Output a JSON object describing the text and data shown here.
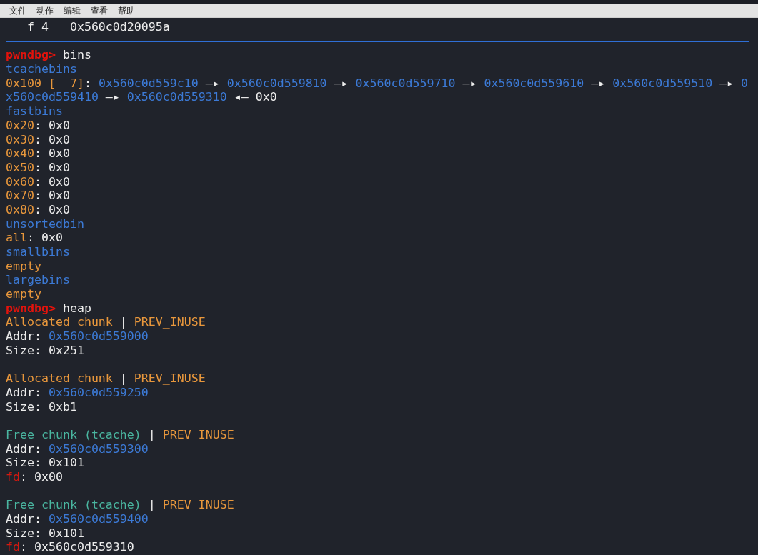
{
  "menu_bar": {
    "items": [
      "文件",
      "动作",
      "编辑",
      "查看",
      "帮助"
    ]
  },
  "terminal": {
    "lines": [
      {
        "kind": "frame",
        "text": "f 4   0x560c0d20095a"
      },
      {
        "kind": "separator"
      },
      {
        "kind": "output",
        "segments": [
          {
            "kind": "prompt",
            "text": "pwndbg>"
          },
          {
            "kind": "text",
            "text": " bins"
          }
        ]
      },
      {
        "kind": "output",
        "segments": [
          {
            "kind": "heading",
            "text": "tcachebins"
          }
        ]
      },
      {
        "kind": "output",
        "segments": [
          {
            "kind": "bin",
            "text": "0x100 [  7]"
          },
          {
            "kind": "text",
            "text": ": "
          },
          {
            "kind": "address",
            "text": "0x560c0d559c10"
          },
          {
            "kind": "text",
            "text": " —▸ "
          },
          {
            "kind": "address",
            "text": "0x560c0d559810"
          },
          {
            "kind": "text",
            "text": " —▸ "
          },
          {
            "kind": "address",
            "text": "0x560c0d559710"
          },
          {
            "kind": "text",
            "text": " —▸ "
          },
          {
            "kind": "address",
            "text": "0x560c0d559610"
          },
          {
            "kind": "text",
            "text": " —▸ "
          },
          {
            "kind": "address",
            "text": "0x560c0d559510"
          },
          {
            "kind": "text",
            "text": " —▸ "
          },
          {
            "kind": "address",
            "text": "0"
          }
        ]
      },
      {
        "kind": "output",
        "segments": [
          {
            "kind": "address",
            "text": "x560c0d559410"
          },
          {
            "kind": "text",
            "text": " —▸ "
          },
          {
            "kind": "address",
            "text": "0x560c0d559310"
          },
          {
            "kind": "text",
            "text": " ◂— 0x0"
          }
        ]
      },
      {
        "kind": "output",
        "segments": [
          {
            "kind": "heading",
            "text": "fastbins"
          }
        ]
      },
      {
        "kind": "output",
        "segments": [
          {
            "kind": "bin",
            "text": "0x20"
          },
          {
            "kind": "text",
            "text": ": 0x0"
          }
        ]
      },
      {
        "kind": "output",
        "segments": [
          {
            "kind": "bin",
            "text": "0x30"
          },
          {
            "kind": "text",
            "text": ": 0x0"
          }
        ]
      },
      {
        "kind": "output",
        "segments": [
          {
            "kind": "bin",
            "text": "0x40"
          },
          {
            "kind": "text",
            "text": ": 0x0"
          }
        ]
      },
      {
        "kind": "output",
        "segments": [
          {
            "kind": "bin",
            "text": "0x50"
          },
          {
            "kind": "text",
            "text": ": 0x0"
          }
        ]
      },
      {
        "kind": "output",
        "segments": [
          {
            "kind": "bin",
            "text": "0x60"
          },
          {
            "kind": "text",
            "text": ": 0x0"
          }
        ]
      },
      {
        "kind": "output",
        "segments": [
          {
            "kind": "bin",
            "text": "0x70"
          },
          {
            "kind": "text",
            "text": ": 0x0"
          }
        ]
      },
      {
        "kind": "output",
        "segments": [
          {
            "kind": "bin",
            "text": "0x80"
          },
          {
            "kind": "text",
            "text": ": 0x0"
          }
        ]
      },
      {
        "kind": "output",
        "segments": [
          {
            "kind": "heading",
            "text": "unsortedbin"
          }
        ]
      },
      {
        "kind": "output",
        "segments": [
          {
            "kind": "bin",
            "text": "all"
          },
          {
            "kind": "text",
            "text": ": 0x0"
          }
        ]
      },
      {
        "kind": "output",
        "segments": [
          {
            "kind": "heading",
            "text": "smallbins"
          }
        ]
      },
      {
        "kind": "output",
        "segments": [
          {
            "kind": "bin",
            "text": "empty"
          }
        ]
      },
      {
        "kind": "output",
        "segments": [
          {
            "kind": "heading",
            "text": "largebins"
          }
        ]
      },
      {
        "kind": "output",
        "segments": [
          {
            "kind": "bin",
            "text": "empty"
          }
        ]
      },
      {
        "kind": "output",
        "segments": [
          {
            "kind": "prompt",
            "text": "pwndbg>"
          },
          {
            "kind": "text",
            "text": " heap"
          }
        ]
      },
      {
        "kind": "output",
        "segments": [
          {
            "kind": "bin",
            "text": "Allocated chunk"
          },
          {
            "kind": "text",
            "text": " | "
          },
          {
            "kind": "bin",
            "text": "PREV_INUSE"
          }
        ]
      },
      {
        "kind": "output",
        "segments": [
          {
            "kind": "text",
            "text": "Addr: "
          },
          {
            "kind": "address",
            "text": "0x560c0d559000"
          }
        ]
      },
      {
        "kind": "output",
        "segments": [
          {
            "kind": "text",
            "text": "Size: 0x251"
          }
        ]
      },
      {
        "kind": "blank"
      },
      {
        "kind": "output",
        "segments": [
          {
            "kind": "bin",
            "text": "Allocated chunk"
          },
          {
            "kind": "text",
            "text": " | "
          },
          {
            "kind": "bin",
            "text": "PREV_INUSE"
          }
        ]
      },
      {
        "kind": "output",
        "segments": [
          {
            "kind": "text",
            "text": "Addr: "
          },
          {
            "kind": "address",
            "text": "0x560c0d559250"
          }
        ]
      },
      {
        "kind": "output",
        "segments": [
          {
            "kind": "text",
            "text": "Size: 0xb1"
          }
        ]
      },
      {
        "kind": "blank"
      },
      {
        "kind": "output",
        "segments": [
          {
            "kind": "free",
            "text": "Free chunk (tcache)"
          },
          {
            "kind": "text",
            "text": " | "
          },
          {
            "kind": "bin",
            "text": "PREV_INUSE"
          }
        ]
      },
      {
        "kind": "output",
        "segments": [
          {
            "kind": "text",
            "text": "Addr: "
          },
          {
            "kind": "address",
            "text": "0x560c0d559300"
          }
        ]
      },
      {
        "kind": "output",
        "segments": [
          {
            "kind": "text",
            "text": "Size: 0x101"
          }
        ]
      },
      {
        "kind": "output",
        "segments": [
          {
            "kind": "pointer",
            "text": "fd"
          },
          {
            "kind": "text",
            "text": ": 0x00"
          }
        ]
      },
      {
        "kind": "blank"
      },
      {
        "kind": "output",
        "segments": [
          {
            "kind": "free",
            "text": "Free chunk (tcache)"
          },
          {
            "kind": "text",
            "text": " | "
          },
          {
            "kind": "bin",
            "text": "PREV_INUSE"
          }
        ]
      },
      {
        "kind": "output",
        "segments": [
          {
            "kind": "text",
            "text": "Addr: "
          },
          {
            "kind": "address",
            "text": "0x560c0d559400"
          }
        ]
      },
      {
        "kind": "output",
        "segments": [
          {
            "kind": "text",
            "text": "Size: 0x101"
          }
        ]
      },
      {
        "kind": "output",
        "segments": [
          {
            "kind": "pointer",
            "text": "fd"
          },
          {
            "kind": "text",
            "text": ": 0x560c0d559310"
          }
        ]
      }
    ]
  }
}
